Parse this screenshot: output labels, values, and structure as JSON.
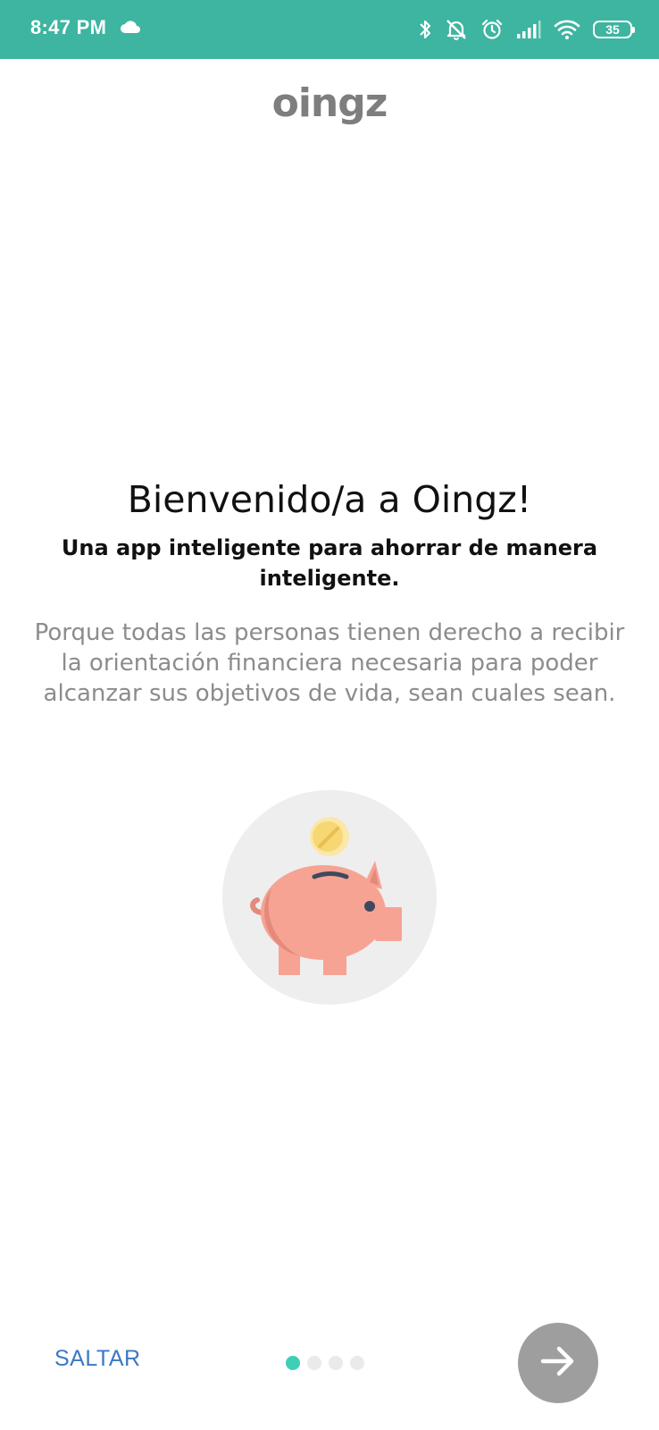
{
  "status_bar": {
    "time": "8:47 PM",
    "battery_level": "35",
    "background_color": "#3db5a0",
    "icons": [
      "cloud-icon",
      "bluetooth-icon",
      "alarm-off-icon",
      "alarm-clock-icon",
      "signal-icon",
      "wifi-icon",
      "battery-icon"
    ]
  },
  "brand": {
    "logo_text": "oingz"
  },
  "welcome": {
    "title": "Bienvenido/a a Oingz!",
    "subtitle": "Una app inteligente para ahorrar de manera inteligente.",
    "description": "Porque todas las personas tienen derecho a recibir la orientación financiera necesaria para poder alcanzar sus objetivos de vida, sean cuales sean."
  },
  "illustration": {
    "icon": "piggy-bank-icon",
    "pig_color": "#f6a393",
    "coin_color": "#f7d774"
  },
  "footer": {
    "skip_label": "SALTAR",
    "page_total": 4,
    "page_current": 1,
    "accent_color": "#3ecfb7",
    "next_icon": "arrow-right-icon"
  }
}
